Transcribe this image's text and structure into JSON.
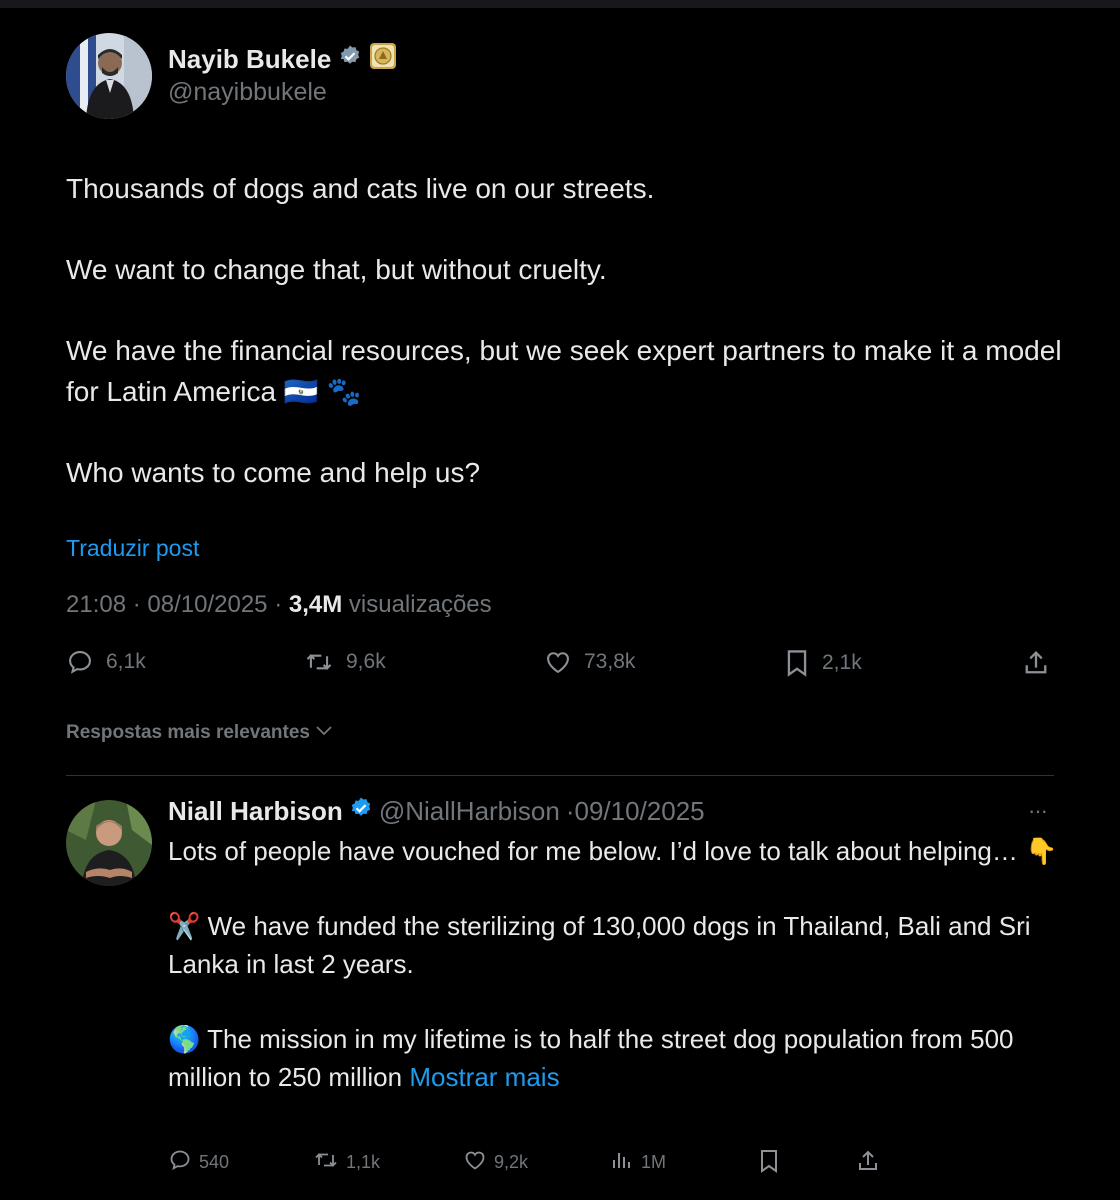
{
  "post": {
    "author_name": "Nayib Bukele",
    "author_handle": "@nayibbukele",
    "paragraphs": [
      "Thousands of dogs and cats live on our streets.",
      "We want to change that, but without cruelty.",
      "We have the financial resources, but we seek expert partners to make it a model for Latin America 🇸🇻 🐾",
      "Who wants to come and help us?"
    ],
    "translate_label": "Traduzir post",
    "time": "21:08",
    "date": "08/10/2025",
    "views_count": "3,4M",
    "views_label": "visualizações",
    "replies": "6,1k",
    "reposts": "9,6k",
    "likes": "73,8k",
    "bookmarks": "2,1k"
  },
  "sort_label": "Respostas mais relevantes",
  "reply": {
    "author_name": "Niall Harbison",
    "author_handle": "@NiallHarbison",
    "date": "·09/10/2025",
    "more_label": "···",
    "paragraphs": [
      "Lots of people have vouched for me below. I’d love to talk about helping…  👇",
      "✂️ We have funded the sterilizing of 130,000 dogs in Thailand, Bali and Sri Lanka in last 2 years.",
      "🌎 The mission in my lifetime is to half the street dog population from 500 million to 250 million"
    ],
    "show_more": "Mostrar mais",
    "replies": "540",
    "reposts": "1,1k",
    "likes": "9,2k",
    "views": "1M"
  },
  "colors": {
    "background": "#000000",
    "text": "#e7e9ea",
    "secondary": "#71767b",
    "accent": "#1d9bf0",
    "divider": "#2f3336"
  },
  "icons": [
    "verified-badge-icon",
    "government-seal-icon",
    "reply-icon",
    "repost-icon",
    "like-icon",
    "bookmark-icon",
    "share-icon",
    "views-icon",
    "chevron-down-icon",
    "more-icon"
  ]
}
